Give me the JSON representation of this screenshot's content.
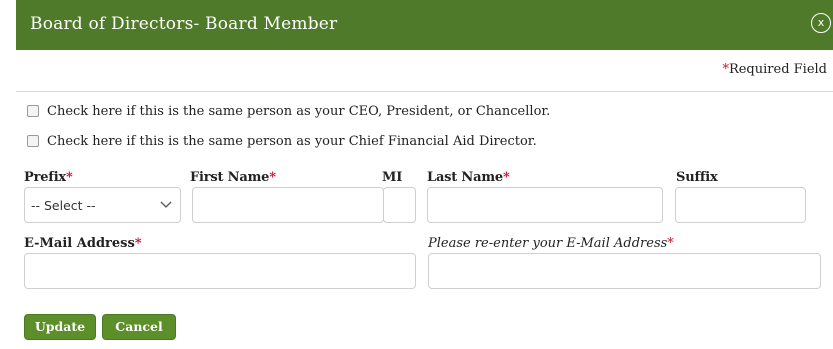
{
  "dialog": {
    "title": "Board of Directors- Board Member",
    "close_label": "x",
    "required_star": "*",
    "required_text": "Required Field"
  },
  "checkboxes": [
    {
      "label": "Check here if this is the same person as your CEO, President, or Chancellor.",
      "checked": false
    },
    {
      "label": "Check here if this is the same person as your Chief Financial Aid Director.",
      "checked": false
    }
  ],
  "fields": {
    "prefix": {
      "label": "Prefix",
      "required": "*",
      "selected": "-- Select --"
    },
    "first_name": {
      "label": "First Name",
      "required": "*",
      "value": ""
    },
    "mi": {
      "label": "MI",
      "value": ""
    },
    "last_name": {
      "label": "Last Name",
      "required": "*",
      "value": ""
    },
    "suffix": {
      "label": "Suffix",
      "value": ""
    },
    "email": {
      "label": "E-Mail Address",
      "required": "*",
      "value": ""
    },
    "email_confirm": {
      "label": "Please re-enter your E-Mail Address",
      "required": "*",
      "value": ""
    }
  },
  "buttons": {
    "update": "Update",
    "cancel": "Cancel"
  },
  "colors": {
    "header": "#4f7a2a",
    "button": "#5c8e2a",
    "required": "#c8102e"
  }
}
